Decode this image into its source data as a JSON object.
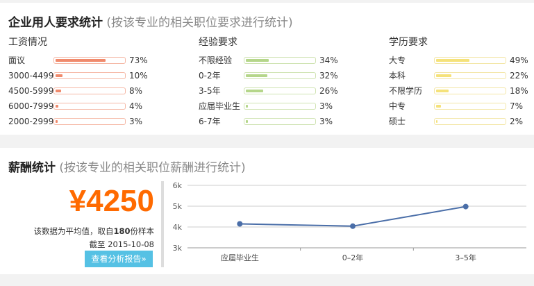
{
  "requirements": {
    "title": "企业用人要求统计",
    "subtitle": "(按该专业的相关职位要求进行统计)",
    "columns": [
      {
        "title": "工资情况",
        "color": "#f08a6c",
        "border": "#f5b8a6",
        "rows": [
          {
            "label": "面议",
            "pct": "73%",
            "value": 73
          },
          {
            "label": "3000-4499",
            "pct": "10%",
            "value": 10
          },
          {
            "label": "4500-5999",
            "pct": "8%",
            "value": 8
          },
          {
            "label": "6000-7999",
            "pct": "4%",
            "value": 4
          },
          {
            "label": "2000-2999",
            "pct": "3%",
            "value": 3
          }
        ]
      },
      {
        "title": "经验要求",
        "color": "#b5d68a",
        "border": "#cfe3b2",
        "rows": [
          {
            "label": "不限经验",
            "pct": "34%",
            "value": 34
          },
          {
            "label": "0-2年",
            "pct": "32%",
            "value": 32
          },
          {
            "label": "3-5年",
            "pct": "26%",
            "value": 26
          },
          {
            "label": "应届毕业生",
            "pct": "3%",
            "value": 3
          },
          {
            "label": "6-7年",
            "pct": "3%",
            "value": 3
          }
        ]
      },
      {
        "title": "学历要求",
        "color": "#f5e27a",
        "border": "#f3e6a6",
        "rows": [
          {
            "label": "大专",
            "pct": "49%",
            "value": 49
          },
          {
            "label": "本科",
            "pct": "22%",
            "value": 22
          },
          {
            "label": "不限学历",
            "pct": "18%",
            "value": 18
          },
          {
            "label": "中专",
            "pct": "7%",
            "value": 7
          },
          {
            "label": "硕士",
            "pct": "2%",
            "value": 2
          }
        ]
      }
    ]
  },
  "salary": {
    "title": "薪酬统计",
    "subtitle": "(按该专业的相关职位薪酬进行统计)",
    "amount": "¥4250",
    "note_prefix": "该数据为平均值，取自",
    "sample_count": "180",
    "note_suffix": "份样本",
    "date_line": "截至 2015-10-08",
    "report_button": "查看分析报告»",
    "accent": "#ff6a00",
    "button_color": "#55c1e4"
  },
  "chart_data": {
    "type": "line",
    "categories": [
      "应届毕业生",
      "0–2年",
      "3–5年"
    ],
    "values": [
      4150,
      4040,
      4980
    ],
    "yticks": [
      "6k",
      "5k",
      "4k",
      "3k"
    ],
    "ylim": [
      3000,
      6000
    ],
    "grid": true,
    "line_color": "#4a6ea8"
  }
}
